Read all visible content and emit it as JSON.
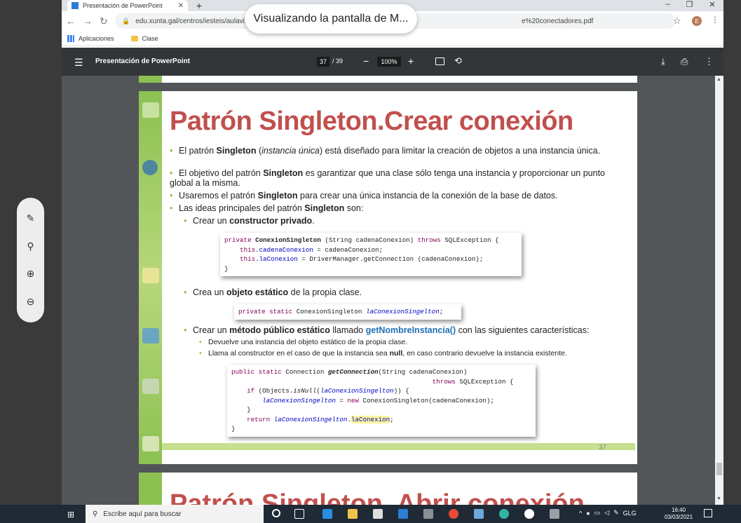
{
  "browser": {
    "tab_title": "Presentación de PowerPoint",
    "url_start": "edu.xunta.gal/centros/iesteis/aulavirtual/pluginfile.php",
    "url_end": "e%20conectadores.pdf",
    "bookmarks": [
      "Aplicaciones",
      "Clase"
    ],
    "profile_initial": "E",
    "toast": "Visualizando la pantalla de M..."
  },
  "pdf": {
    "title": "Presentación de PowerPoint",
    "page_current": "37",
    "page_total": "/ 39",
    "zoom": "100%"
  },
  "slide": {
    "title": "Patrón Singleton.Crear conexión",
    "b1_pre": "El patrón ",
    "b1_bold": "Singleton",
    "b1_it": "instancia única",
    "b1_post": ") está diseñado para limitar la creación de objetos a una instancia única.",
    "b2_pre": "El objetivo del patrón ",
    "b2_bold": "Singleton",
    "b2_post": " es garantizar que una clase sólo tenga una instancia y proporcionar un punto global a la misma.",
    "b3_pre": "Usaremos el patrón ",
    "b3_bold": "Singleton",
    "b3_post": " para crear una única instancia de la conexión de la base de datos.",
    "b4_pre": "Las ideas principales del patrón ",
    "b4_bold": "Singleton",
    "b4_post": " son:",
    "s1_pre": "Crear un ",
    "s1_bold": "constructor privado",
    "s1_post": ".",
    "s2_pre": "Crea un ",
    "s2_bold": "objeto estático",
    "s2_post": " de la propia clase.",
    "s3_pre": "Crear un ",
    "s3_bold": "método público estático",
    "s3_mid": " llamado ",
    "s3_method": "getNombreInstancia()",
    "s3_post": " con las siguientes características:",
    "t1": "Devuelve una instancia del objeto estático de la propia clase.",
    "t2_pre": "Llama al constructor en el caso de que la instancia sea ",
    "t2_bold": "null",
    "t2_post": ", en caso contrario devuelve la instancia existente.",
    "slide_number": "37",
    "next_title": "Patrón Singleton. Abrir conexión"
  },
  "code1": {
    "l1_kw": "private ",
    "l1_name": "ConexionSingleton",
    "l1_rest": " (String cadenaConexion) ",
    "l1_kw2": "throws",
    "l1_end": " SQLException {",
    "l2_kw": "this",
    "l2_fld": ".cadenaConexion",
    "l2_rest": " = cadenaConexion;",
    "l3_kw": "this",
    "l3_fld": ".laConexion",
    "l3_rest": " = DriverManager.getConnection (cadenaConexion);",
    "l4": "}"
  },
  "code2": {
    "kw": "private static ",
    "type": "ConexionSingleton ",
    "fld": "laConexionSingelton",
    "end": ";"
  },
  "code3": {
    "l1_kw": "public static ",
    "l1_type": "Connection ",
    "l1_name": "getConnection",
    "l1_rest": "(String cadenaConexion)",
    "l2_kw": "throws",
    "l2_rest": " SQLException {",
    "l3_kw": "if",
    "l3_a": " (Objects.",
    "l3_it": "isNull",
    "l3_b": "(",
    "l3_fld": "laConexionSingelton",
    "l3_c": ")) {",
    "l4_fld": "laConexionSingelton",
    "l4_a": " = ",
    "l4_kw": "new",
    "l4_b": " ConexionSingleton(cadenaConexion);",
    "l5": "}",
    "l6_kw": "return ",
    "l6_fld": "laConexionSingelton",
    "l6_dot": ".",
    "l6_fld2": "laConexion",
    "l6_end": ";",
    "l7": "}"
  },
  "taskbar": {
    "search": "Escribe aquí para buscar",
    "lang": "GLG",
    "time": "16:40",
    "date": "03/03/2021"
  },
  "colors": {
    "title_red": "#c0504d",
    "slide_green": "#8cc152",
    "method_blue": "#1f6fb5"
  }
}
